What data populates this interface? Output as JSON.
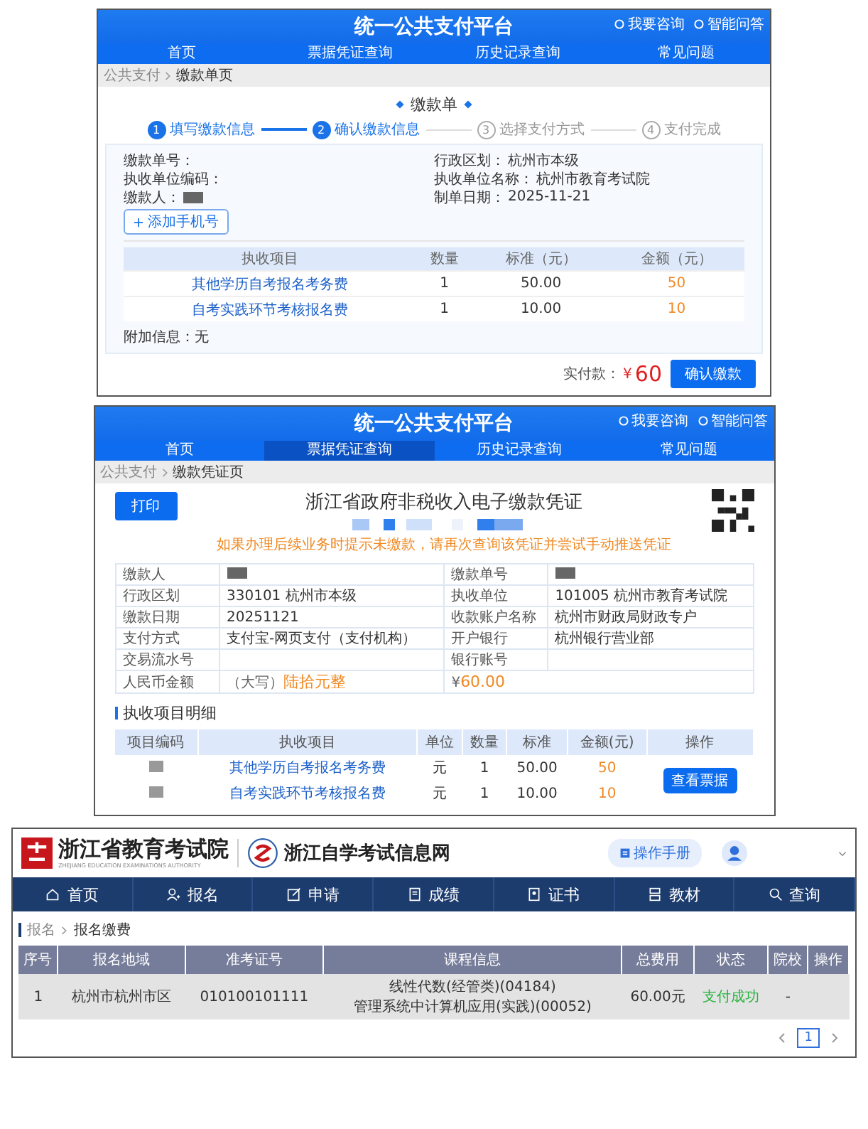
{
  "payment_form": {
    "header": {
      "title": "统一公共支付平台",
      "links": [
        "我要咨询",
        "智能问答"
      ]
    },
    "nav": [
      {
        "label": "首页",
        "selected": false
      },
      {
        "label": "票据凭证查询",
        "selected": false
      },
      {
        "label": "历史记录查询",
        "selected": false
      },
      {
        "label": "常见问题",
        "selected": false
      }
    ],
    "breadcrumb": [
      "公共支付",
      "缴款单页"
    ],
    "form_title": "缴款单",
    "steps": [
      {
        "number": "1",
        "label": "填写缴款信息",
        "active": true
      },
      {
        "number": "2",
        "label": "确认缴款信息",
        "active": true
      },
      {
        "number": "3",
        "label": "选择支付方式",
        "active": false
      },
      {
        "number": "4",
        "label": "支付完成",
        "active": false
      }
    ],
    "fields_left": [
      {
        "label": "缴款单号："
      },
      {
        "label": "执收单位编码："
      },
      {
        "label": "缴款人：",
        "redacted": true
      }
    ],
    "fields_right": [
      {
        "label": "行政区划：",
        "value": "杭州市本级"
      },
      {
        "label": "执收单位名称：",
        "value": "杭州市教育考试院"
      },
      {
        "label": "制单日期：",
        "value": "2025-11-21"
      }
    ],
    "add_phone_button": "添加手机号",
    "table": {
      "columns": [
        "执收项目",
        "数量",
        "标准（元）",
        "金额（元）"
      ],
      "rows": [
        [
          "其他学历自考报名考务费",
          "1",
          "50.00",
          "50"
        ],
        [
          "自考实践环节考核报名费",
          "1",
          "10.00",
          "10"
        ]
      ]
    },
    "extra_info": {
      "label": "附加信息：",
      "value": "无"
    },
    "total": {
      "label": "实付款：",
      "currency": "¥",
      "amount": "60"
    },
    "confirm_button": "确认缴款"
  },
  "voucher": {
    "header": {
      "title": "统一公共支付平台",
      "links": [
        "我要咨询",
        "智能问答"
      ]
    },
    "nav": [
      {
        "label": "首页",
        "selected": false
      },
      {
        "label": "票据凭证查询",
        "selected": true
      },
      {
        "label": "历史记录查询",
        "selected": false
      },
      {
        "label": "常见问题",
        "selected": false
      }
    ],
    "breadcrumb": [
      "公共支付",
      "缴款凭证页"
    ],
    "print_button": "打印",
    "title": "浙江省政府非税收入电子缴款凭证",
    "notice": "如果办理后续业务时提示未缴款，请再次查询该凭证并尝试手动推送凭证",
    "details": [
      {
        "kind": "pair",
        "cells": [
          {
            "label": "缴款人",
            "redacted": true
          },
          {
            "label": "缴款单号",
            "redacted": true
          }
        ]
      },
      {
        "kind": "pair",
        "cells": [
          {
            "label": "行政区划",
            "value": "330101  杭州市本级"
          },
          {
            "label": "执收单位",
            "value": "101005  杭州市教育考试院"
          }
        ]
      },
      {
        "kind": "pair",
        "cells": [
          {
            "label": "缴款日期",
            "value": "20251121"
          },
          {
            "label": "收款账户名称",
            "value": "杭州市财政局财政专户"
          }
        ]
      },
      {
        "kind": "pair",
        "cells": [
          {
            "label": "支付方式",
            "value": "支付宝-网页支付（支付机构）"
          },
          {
            "label": "开户银行",
            "value": "杭州银行营业部"
          }
        ]
      },
      {
        "kind": "pair",
        "cells": [
          {
            "label": "交易流水号"
          },
          {
            "label": "银行账号"
          }
        ]
      },
      {
        "kind": "amount",
        "label": "人民币金额",
        "words_prefix": "（大写）",
        "words": "陆拾元整",
        "currency": "¥",
        "amount": "60.00"
      }
    ],
    "section_title": "执收项目明细",
    "items": {
      "columns": [
        "项目编码",
        "执收项目",
        "单位",
        "数量",
        "标准",
        "金额(元)",
        "操作"
      ],
      "rows": [
        {
          "code_redacted": true,
          "name": "其他学历自考报名考务费",
          "unit": "元",
          "quantity": "1",
          "standard": "50.00",
          "amount": "50"
        },
        {
          "code_redacted": true,
          "name": "自考实践环节考核报名费",
          "unit": "元",
          "quantity": "1",
          "standard": "10.00",
          "amount": "10"
        }
      ],
      "action_button": "查看票据"
    }
  },
  "exam_site": {
    "authority_name": "浙江省教育考试院",
    "authority_subtitle": "ZHEJIANG EDUCATION EXAMINATIONS AUTHORITY",
    "site_name": "浙江自学考试信息网",
    "manual_button": "操作手册",
    "nav": [
      {
        "label": "首页",
        "kind": "home"
      },
      {
        "label": "报名",
        "kind": "user"
      },
      {
        "label": "申请",
        "kind": "edit"
      },
      {
        "label": "成绩",
        "kind": "scroll"
      },
      {
        "label": "证书",
        "kind": "certificate"
      },
      {
        "label": "教材",
        "kind": "book"
      },
      {
        "label": "查询",
        "kind": "search"
      }
    ],
    "breadcrumb": [
      "报名",
      "报名缴费"
    ],
    "table": {
      "columns": [
        "序号",
        "报名地域",
        "准考证号",
        "课程信息",
        "总费用",
        "状态",
        "院校",
        "操作"
      ],
      "rows": [
        {
          "index": "1",
          "region": "杭州市杭州市区",
          "ticket_number": "010100101111",
          "courses": [
            "线性代数(经管类)(04184)",
            "管理系统中计算机应用(实践)(00052)"
          ],
          "total_fee": "60.00元",
          "status": "支付成功",
          "school": "-"
        }
      ]
    },
    "pagination": [
      {
        "label": "1",
        "selected": true
      }
    ]
  }
}
